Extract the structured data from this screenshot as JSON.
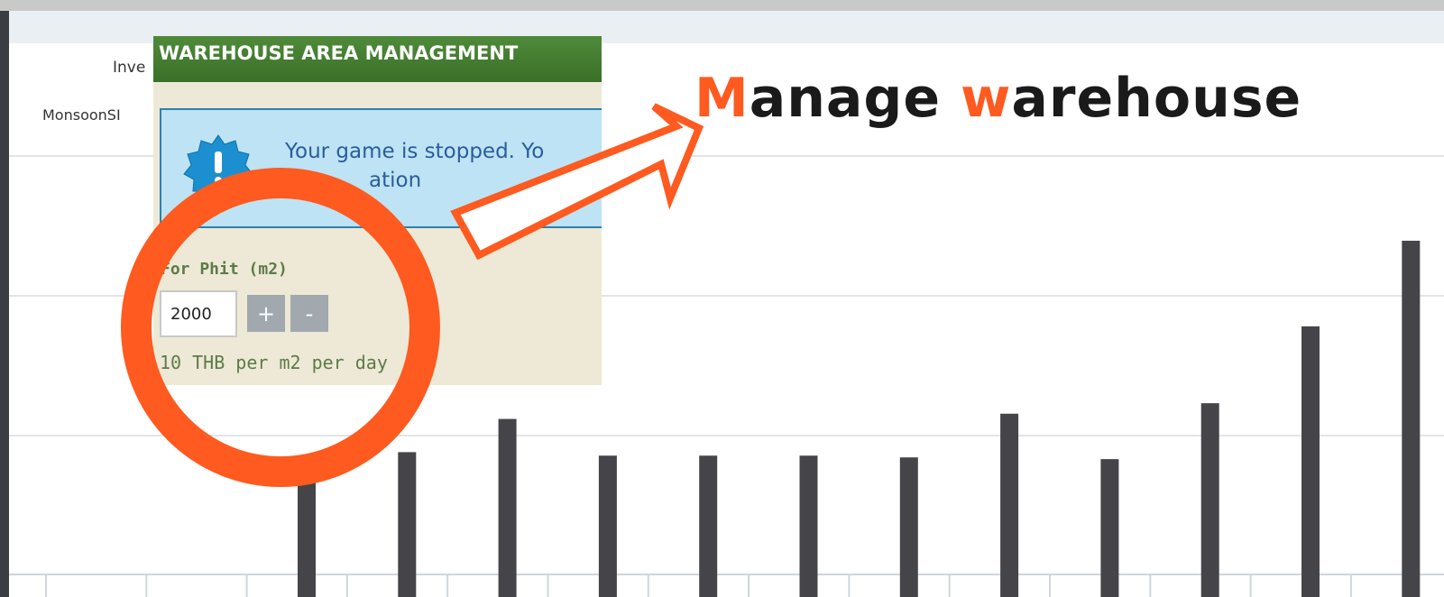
{
  "background_table": {
    "row_label_1": "Inve",
    "row_label_2": "MonsoonSI"
  },
  "chart_data": {
    "type": "bar",
    "color": "#454549",
    "values": [
      3.0,
      3.5,
      4.45,
      3.4,
      3.4,
      3.4,
      3.35,
      4.6,
      3.3,
      4.9,
      7.1,
      9.55
    ],
    "ylim": [
      0,
      12
    ],
    "grid": true
  },
  "dialog": {
    "title": "WAREHOUSE AREA MANAGEMENT",
    "notice_line_1": "Your game is stopped. Yo",
    "notice_line_2": "ation",
    "notice_icon": "info-badge-icon",
    "field_label": "For Phit (m2)",
    "quantity_value": "2000",
    "plus_label": "+",
    "minus_label": "-",
    "price_note": "10 THB per m2 per day"
  },
  "annotation": {
    "color": "#ff5a1f",
    "callout_letter_1": "M",
    "callout_rest_1": "anage ",
    "callout_letter_2": "w",
    "callout_rest_2": "arehouse"
  }
}
